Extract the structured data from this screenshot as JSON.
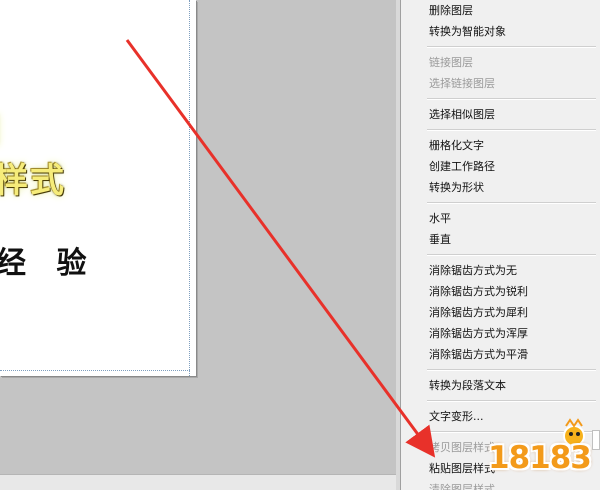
{
  "canvas": {
    "styled_line_1": "制",
    "styled_line_2": "样式",
    "plain_line": "经 验"
  },
  "menu": {
    "groups": [
      {
        "items": [
          {
            "label": "删除图层",
            "enabled": true
          },
          {
            "label": "转换为智能对象",
            "enabled": true
          }
        ]
      },
      {
        "items": [
          {
            "label": "链接图层",
            "enabled": false
          },
          {
            "label": "选择链接图层",
            "enabled": false
          }
        ]
      },
      {
        "items": [
          {
            "label": "选择相似图层",
            "enabled": true
          }
        ]
      },
      {
        "items": [
          {
            "label": "栅格化文字",
            "enabled": true
          },
          {
            "label": "创建工作路径",
            "enabled": true
          },
          {
            "label": "转换为形状",
            "enabled": true
          }
        ]
      },
      {
        "items": [
          {
            "label": "水平",
            "enabled": true
          },
          {
            "label": "垂直",
            "enabled": true
          }
        ]
      },
      {
        "items": [
          {
            "label": "消除锯齿方式为无",
            "enabled": true
          },
          {
            "label": "消除锯齿方式为锐利",
            "enabled": true
          },
          {
            "label": "消除锯齿方式为犀利",
            "enabled": true
          },
          {
            "label": "消除锯齿方式为浑厚",
            "enabled": true
          },
          {
            "label": "消除锯齿方式为平滑",
            "enabled": true
          }
        ]
      },
      {
        "items": [
          {
            "label": "转换为段落文本",
            "enabled": true
          }
        ]
      },
      {
        "items": [
          {
            "label": "文字变形...",
            "enabled": true
          }
        ]
      },
      {
        "items": [
          {
            "label": "拷贝图层样式",
            "enabled": false
          },
          {
            "label": "粘贴图层样式",
            "enabled": true
          },
          {
            "label": "清除图层样式",
            "enabled": false
          }
        ]
      }
    ]
  },
  "watermark": {
    "text": "18183"
  },
  "colors": {
    "arrow": "#e8312a",
    "menu_bg": "#f0f0f0",
    "disabled_text": "#9a9a9a",
    "workspace_bg": "#c4c4c4"
  }
}
